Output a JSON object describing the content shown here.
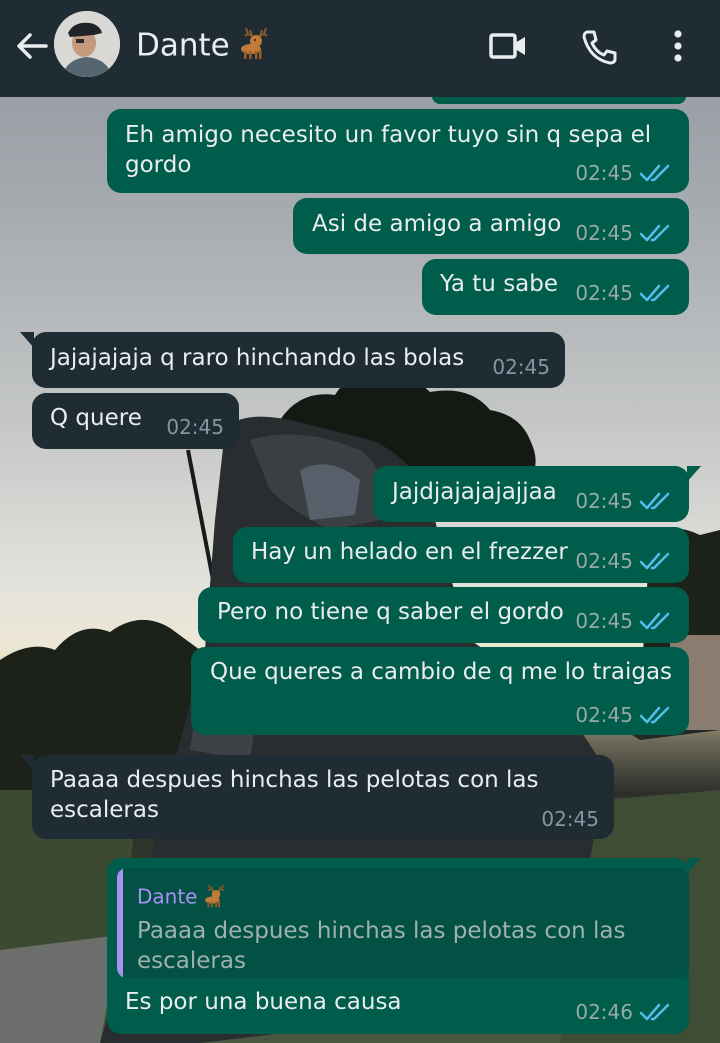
{
  "header": {
    "contact_name": "Dante",
    "icons": [
      "arrow-back-icon",
      "deer-emoji-icon",
      "video-call-icon",
      "phone-call-icon",
      "more-vert-icon"
    ]
  },
  "colors": {
    "header_bg": "#1f2c34",
    "outgoing_bubble": "#005c4b",
    "incoming_bubble": "#1f2c34",
    "read_ticks": "#53bdeb",
    "quote_accent": "#a791f3"
  },
  "messages": [
    {
      "dir": "out",
      "lines": [
        "Eh amigo necesito un favor tuyo sin q sepa el",
        "gordo"
      ],
      "time": "02:45",
      "status": "read"
    },
    {
      "dir": "out",
      "lines": [
        "Asi de amigo a amigo"
      ],
      "time": "02:45",
      "status": "read"
    },
    {
      "dir": "out",
      "lines": [
        "Ya tu sabe"
      ],
      "time": "02:45",
      "status": "read"
    },
    {
      "dir": "in",
      "lines": [
        "Jajajajaja q raro hinchando las bolas"
      ],
      "time": "02:45"
    },
    {
      "dir": "in",
      "lines": [
        "Q quere"
      ],
      "time": "02:45"
    },
    {
      "dir": "out",
      "lines": [
        "Jajdjajajajajjaa"
      ],
      "time": "02:45",
      "status": "read"
    },
    {
      "dir": "out",
      "lines": [
        "Hay un helado en el frezzer"
      ],
      "time": "02:45",
      "status": "read"
    },
    {
      "dir": "out",
      "lines": [
        "Pero no tiene q saber el gordo"
      ],
      "time": "02:45",
      "status": "read"
    },
    {
      "dir": "out",
      "lines": [
        "Que queres a cambio de q me lo traigas"
      ],
      "time": "02:45",
      "status": "read"
    },
    {
      "dir": "in",
      "lines": [
        "Paaaa despues hinchas las pelotas con las",
        "escaleras"
      ],
      "time": "02:45"
    },
    {
      "dir": "out",
      "quote": {
        "name": "Dante",
        "lines": [
          "Paaaa despues hinchas las pelotas con las",
          "escaleras"
        ]
      },
      "lines": [
        "Es por una buena causa"
      ],
      "time": "02:46",
      "status": "read"
    }
  ]
}
